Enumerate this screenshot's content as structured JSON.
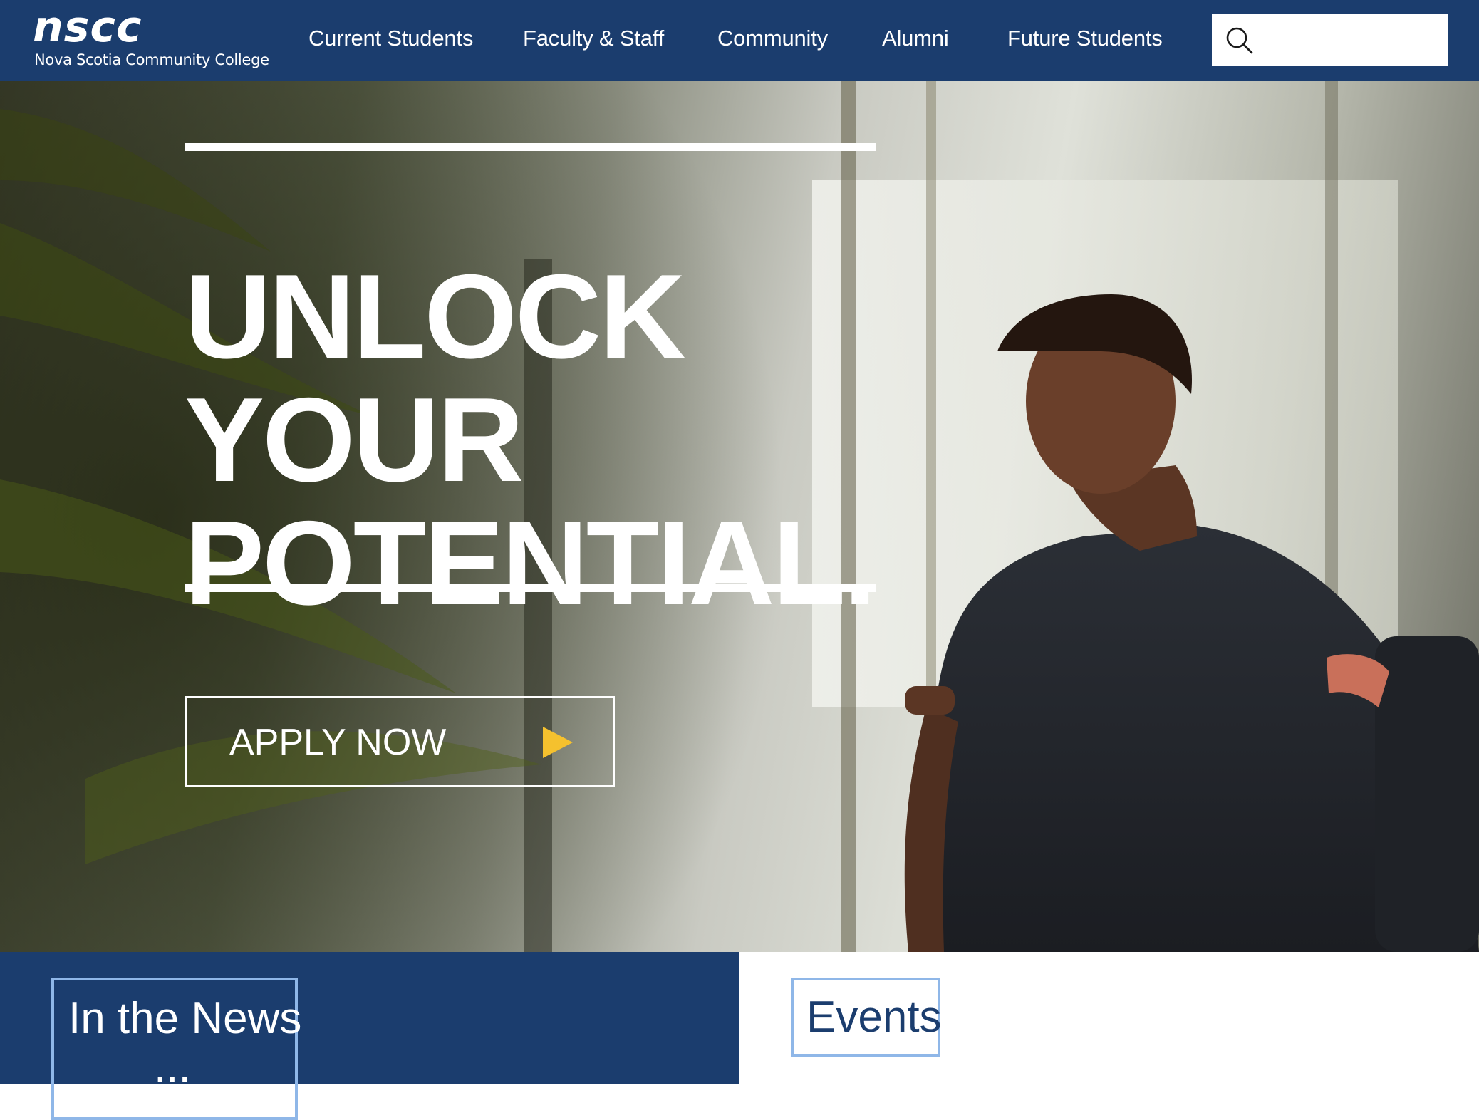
{
  "header": {
    "logo": {
      "mark": "nscc",
      "subtitle": "Nova Scotia Community College"
    },
    "nav": [
      {
        "label": "Current Students"
      },
      {
        "label": "Faculty & Staff"
      },
      {
        "label": "Community"
      },
      {
        "label": "Alumni"
      },
      {
        "label": "Future Students"
      }
    ],
    "search": {
      "placeholder": "",
      "value": "",
      "icon": "search-icon"
    }
  },
  "hero": {
    "headline": [
      "UNLOCK",
      "YOUR",
      "POTENTIAL."
    ],
    "cta": {
      "label": "APPLY NOW",
      "icon": "play-arrow-icon"
    }
  },
  "sections": {
    "news": {
      "title": "In the News",
      "more": "..."
    },
    "events": {
      "title": "Events"
    }
  },
  "colors": {
    "brand_navy": "#1b3d6e",
    "accent_light_blue": "#8fb7e8",
    "cta_arrow_yellow": "#f5c12e",
    "text_white": "#ffffff"
  }
}
